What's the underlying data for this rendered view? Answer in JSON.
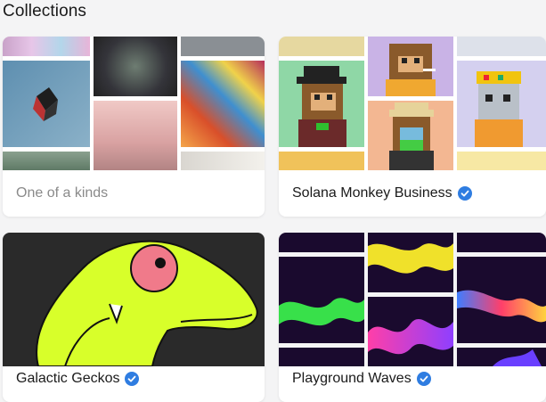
{
  "section": {
    "title": "Collections"
  },
  "collections": [
    {
      "name": "One of a kinds",
      "verified": false
    },
    {
      "name": "Solana Monkey Business",
      "verified": true
    },
    {
      "name": "Galactic Geckos",
      "verified": true
    },
    {
      "name": "Playground Waves",
      "verified": true
    }
  ],
  "colors": {
    "verified": "#2f7de1",
    "gecko": "#d8ff2a",
    "waves_bg": "#1a0a2e"
  }
}
